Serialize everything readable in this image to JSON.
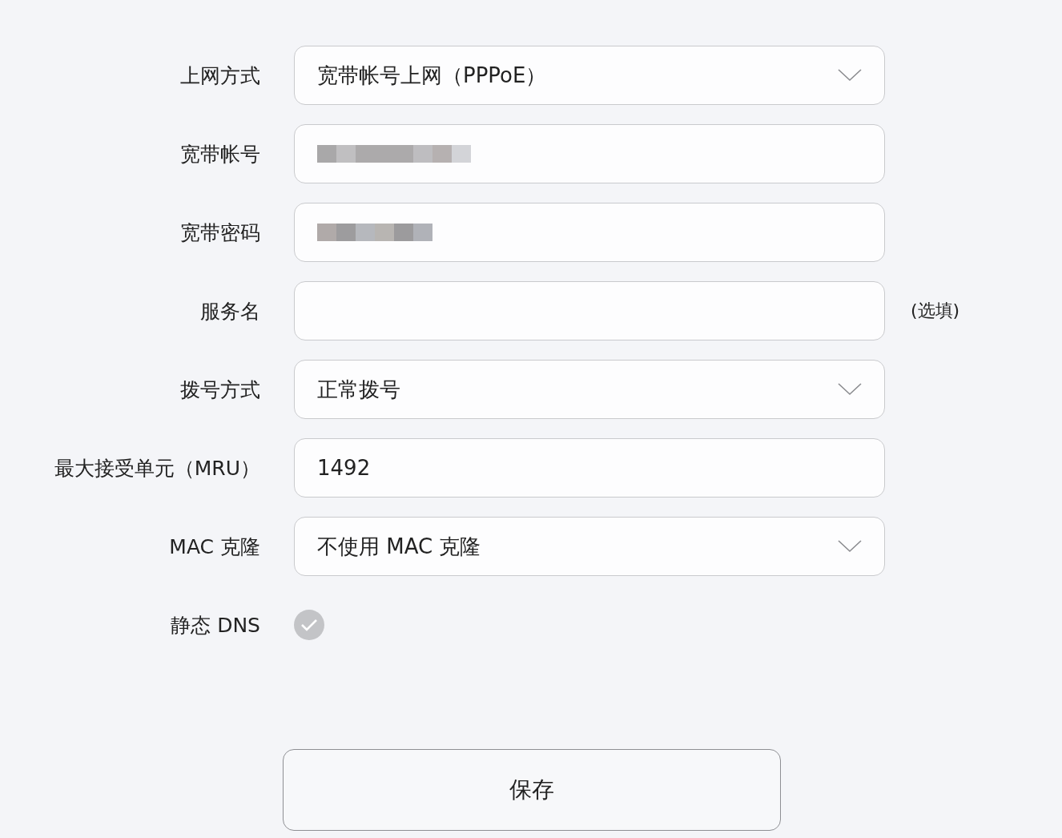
{
  "fields": [
    {
      "label": "上网方式",
      "kind": "select",
      "value": "宽带帐号上网（PPPoE）"
    },
    {
      "label": "宽带帐号",
      "kind": "text",
      "masked": true
    },
    {
      "label": "宽带密码",
      "kind": "text",
      "masked": true
    },
    {
      "label": "服务名",
      "kind": "text",
      "hint": "(选填)"
    },
    {
      "label": "拨号方式",
      "kind": "select",
      "value": "正常拨号"
    },
    {
      "label": "最大接受单元（MRU）",
      "kind": "text",
      "value": "1492"
    },
    {
      "label": "MAC 克隆",
      "kind": "select",
      "value": "不使用 MAC 克隆"
    },
    {
      "label": "静态 DNS",
      "kind": "checkbox",
      "checked": true
    }
  ],
  "save_button": "保存"
}
